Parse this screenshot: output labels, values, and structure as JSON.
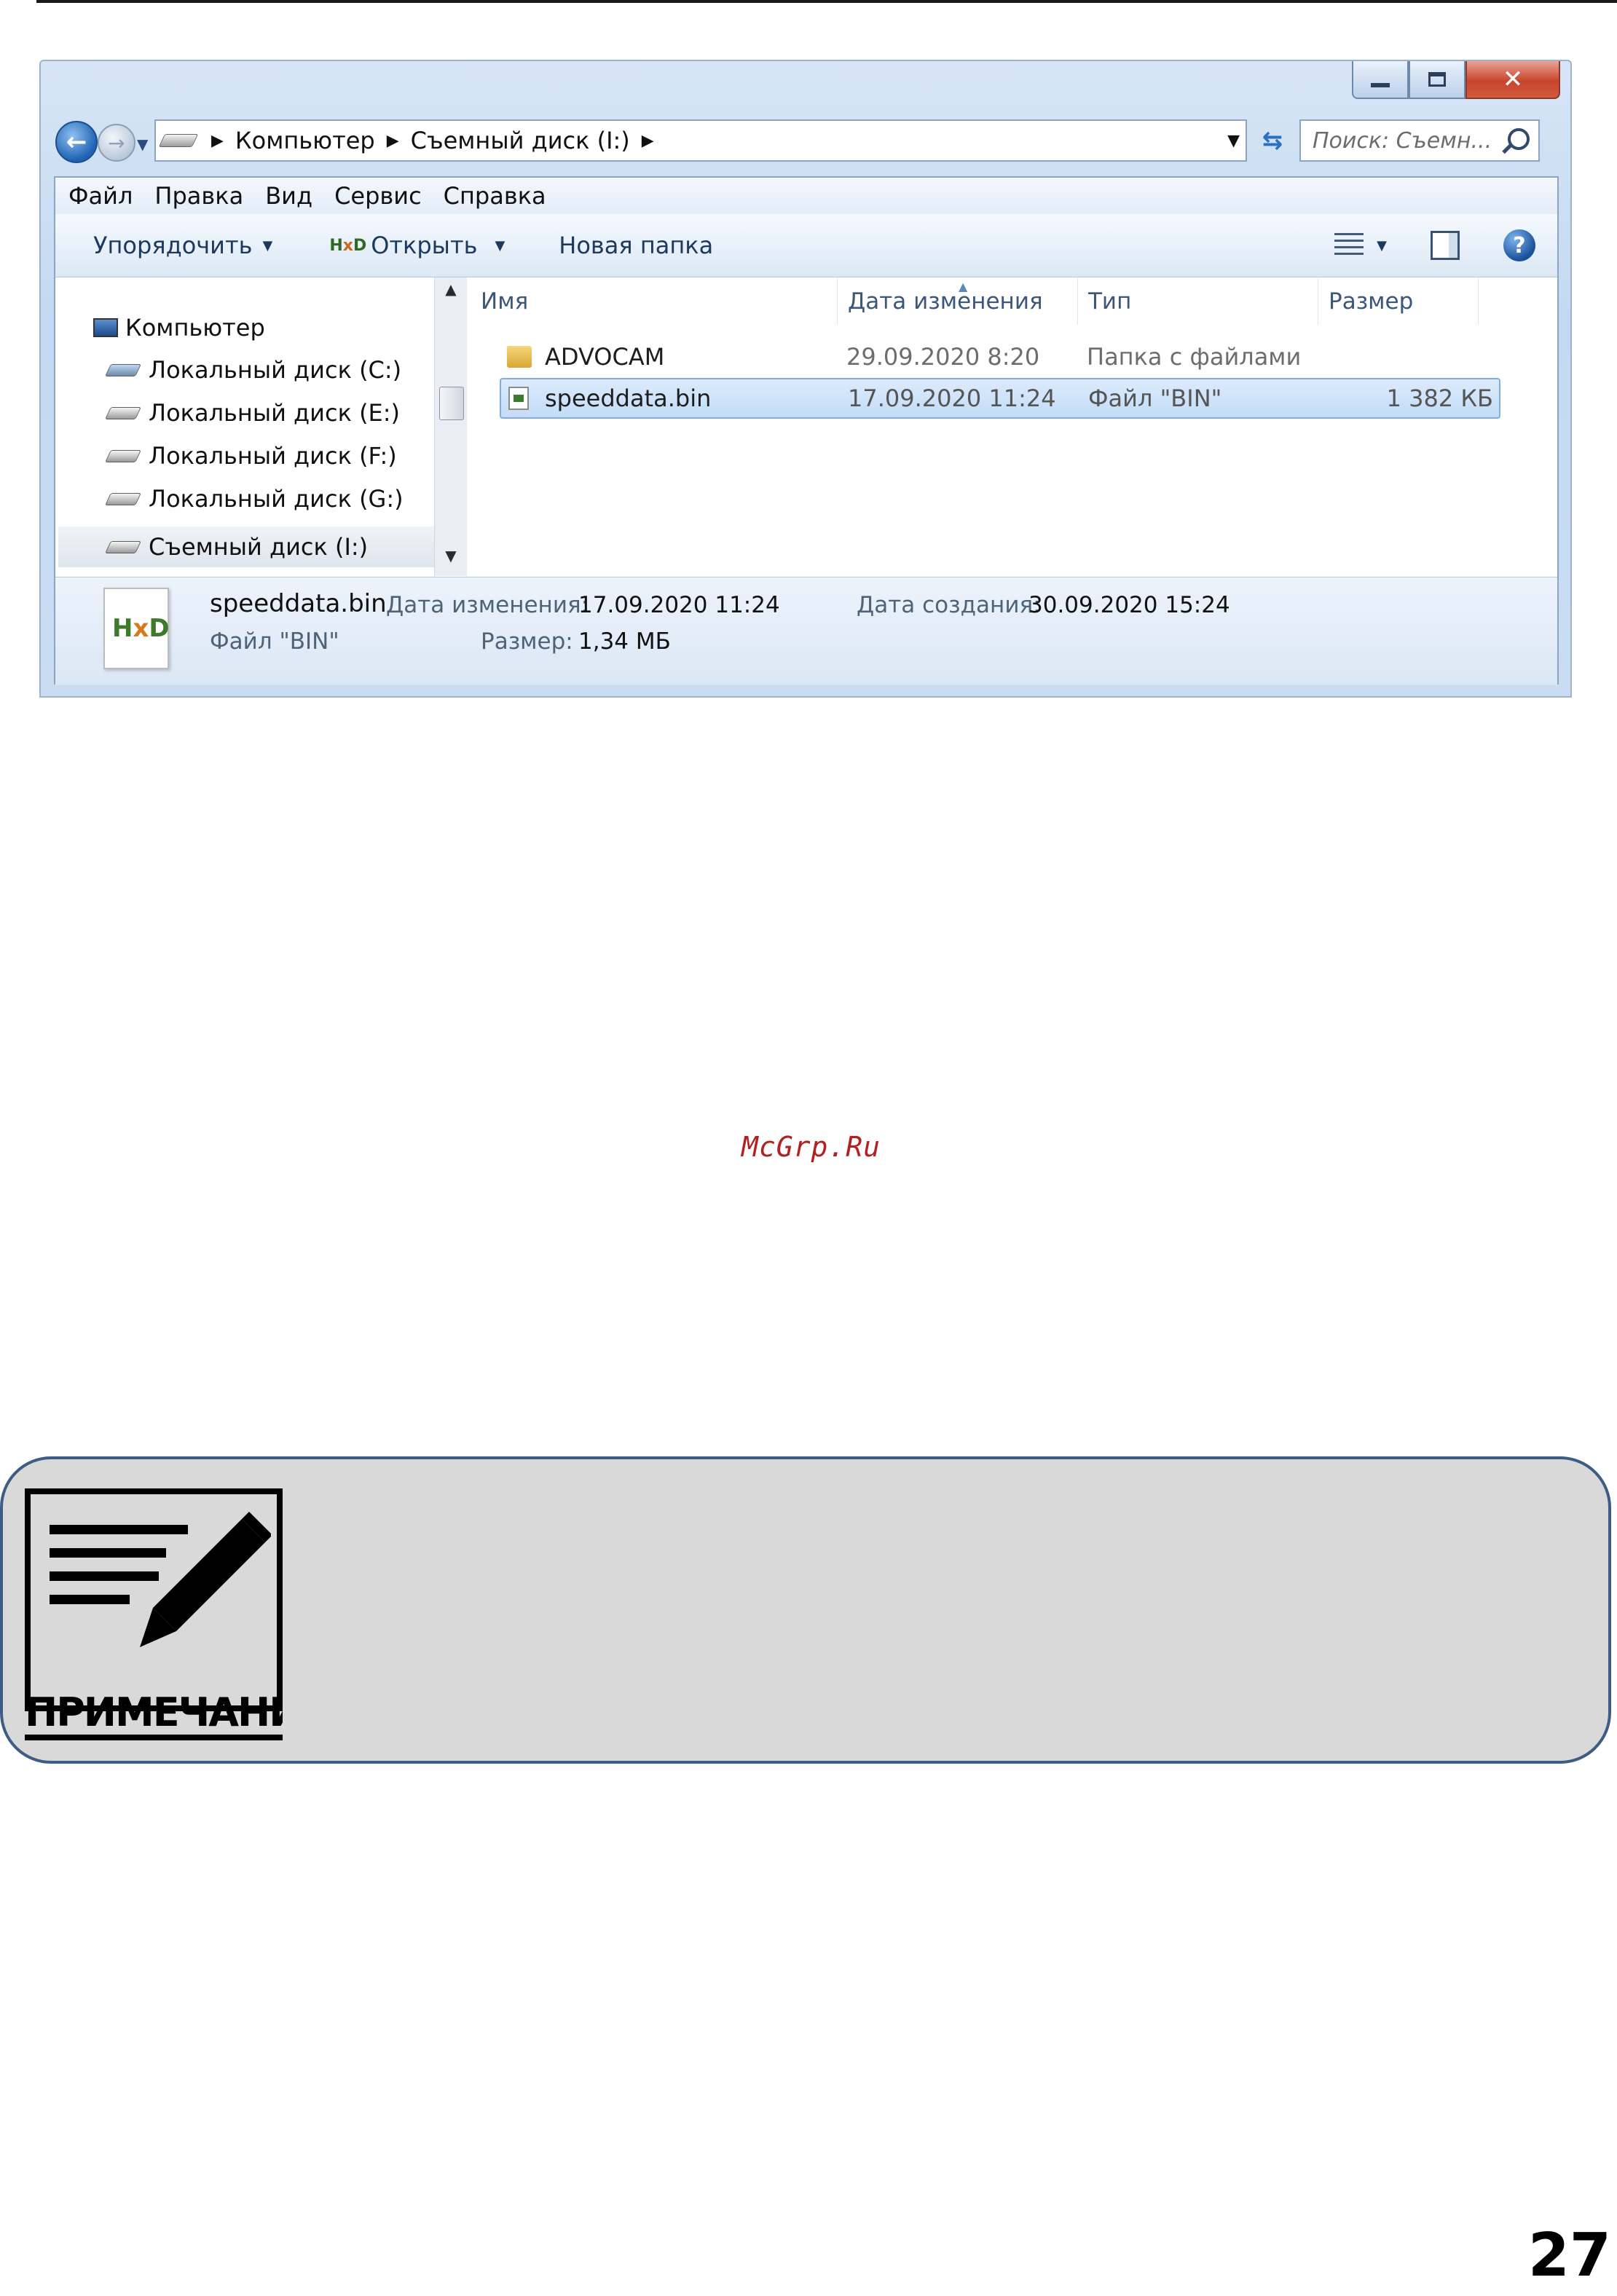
{
  "window": {
    "nav": {
      "address": [
        "Компьютер",
        "Съемный диск (I:)"
      ],
      "search_placeholder": "Поиск: Съемн..."
    },
    "menu": [
      "Файл",
      "Правка",
      "Вид",
      "Сервис",
      "Справка"
    ],
    "toolbar": {
      "organize": "Упорядочить",
      "open": "Открыть",
      "new_folder": "Новая папка"
    },
    "sidebar": {
      "items": [
        {
          "label": "Компьютер",
          "icon": "computer-icon"
        },
        {
          "label": "Локальный диск (C:)",
          "icon": "system-drive-icon"
        },
        {
          "label": "Локальный диск (E:)",
          "icon": "drive-icon"
        },
        {
          "label": "Локальный диск (F:)",
          "icon": "drive-icon"
        },
        {
          "label": "Локальный диск (G:)",
          "icon": "drive-icon"
        },
        {
          "label": "Съемный диск (I:)",
          "icon": "drive-icon",
          "selected": true
        }
      ]
    },
    "columns": [
      "Имя",
      "Дата изменения",
      "Тип",
      "Размер"
    ],
    "files": [
      {
        "name": "ADVOCAM",
        "date": "29.09.2020 8:20",
        "type": "Папка с файлами",
        "size": "",
        "icon": "folder-icon"
      },
      {
        "name": "speeddata.bin",
        "date": "17.09.2020 11:24",
        "type": "Файл \"BIN\"",
        "size": "1 382 КБ",
        "icon": "bin-file-icon",
        "selected": true
      }
    ],
    "details": {
      "filename": "speeddata.bin",
      "filetype": "Файл \"BIN\"",
      "modified_label": "Дата изменения:",
      "modified_value": "17.09.2020 11:24",
      "created_label": "Дата создания:",
      "created_value": "30.09.2020 15:24",
      "size_label": "Размер:",
      "size_value": "1,34 МБ"
    }
  },
  "watermark": "McGrp.Ru",
  "note": {
    "label": "ПРИМЕЧАНИЕ"
  },
  "page_number": "27"
}
